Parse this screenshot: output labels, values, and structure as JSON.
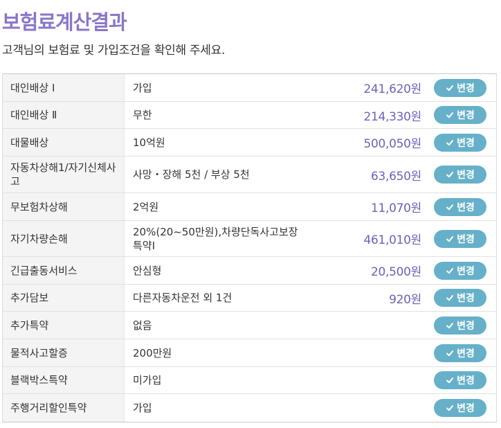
{
  "header": {
    "title": "보험료계산결과",
    "subtitle": "고객님의 보험료 및 가입조건을 확인해 주세요."
  },
  "colors": {
    "title": "#8a76c9",
    "amount": "#6f5fb7",
    "button": "#66b0c9"
  },
  "button_label": "변경",
  "rows": [
    {
      "label": "대인배상 Ⅰ",
      "value": "가입",
      "amount": "241,620원"
    },
    {
      "label": "대인배상 Ⅱ",
      "value": "무한",
      "amount": "214,330원"
    },
    {
      "label": "대물배상",
      "value": "10억원",
      "amount": "500,050원"
    },
    {
      "label": "자동차상해1/자기신체사고",
      "value": "사망・장해 5천 / 부상 5천",
      "amount": "63,650원"
    },
    {
      "label": "무보험차상해",
      "value": "2억원",
      "amount": "11,070원"
    },
    {
      "label": "자기차량손해",
      "value": "20%(20~50만원),차량단독사고보장특약I",
      "amount": "461,010원"
    },
    {
      "label": "긴급출동서비스",
      "value": "안심형",
      "amount": "20,500원"
    },
    {
      "label": "추가담보",
      "value": "다른자동차운전 외 1건",
      "amount": "920원"
    },
    {
      "label": "추가특약",
      "value": "없음",
      "amount": ""
    },
    {
      "label": "물적사고할증",
      "value": "200만원",
      "amount": ""
    },
    {
      "label": "블랙박스특약",
      "value": "미가입",
      "amount": ""
    },
    {
      "label": "주행거리할인특약",
      "value": "가입",
      "amount": ""
    }
  ]
}
